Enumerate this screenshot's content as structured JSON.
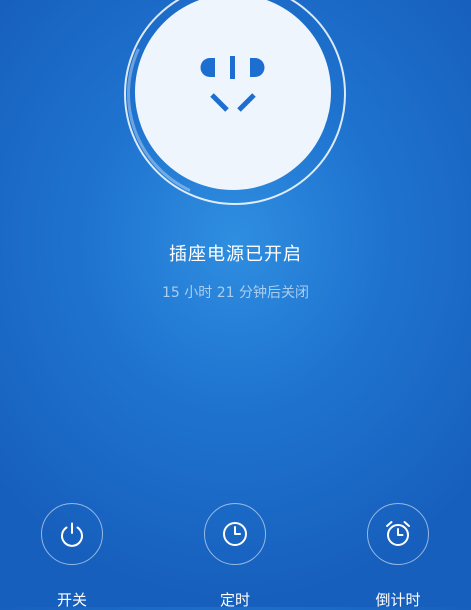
{
  "status": {
    "title": "插座电源已开启",
    "subtitle": "15 小时 21 分钟后关闭"
  },
  "socket": {
    "icon": "power-socket-icon",
    "face_color": "#eef5fd",
    "accent": "#1c6fd0"
  },
  "actions": [
    {
      "label": "开关",
      "icon": "power-icon"
    },
    {
      "label": "定时",
      "icon": "clock-icon"
    },
    {
      "label": "倒计时",
      "icon": "alarm-clock-icon"
    }
  ],
  "colors": {
    "background": "#1f74d0",
    "text": "#ffffff"
  }
}
